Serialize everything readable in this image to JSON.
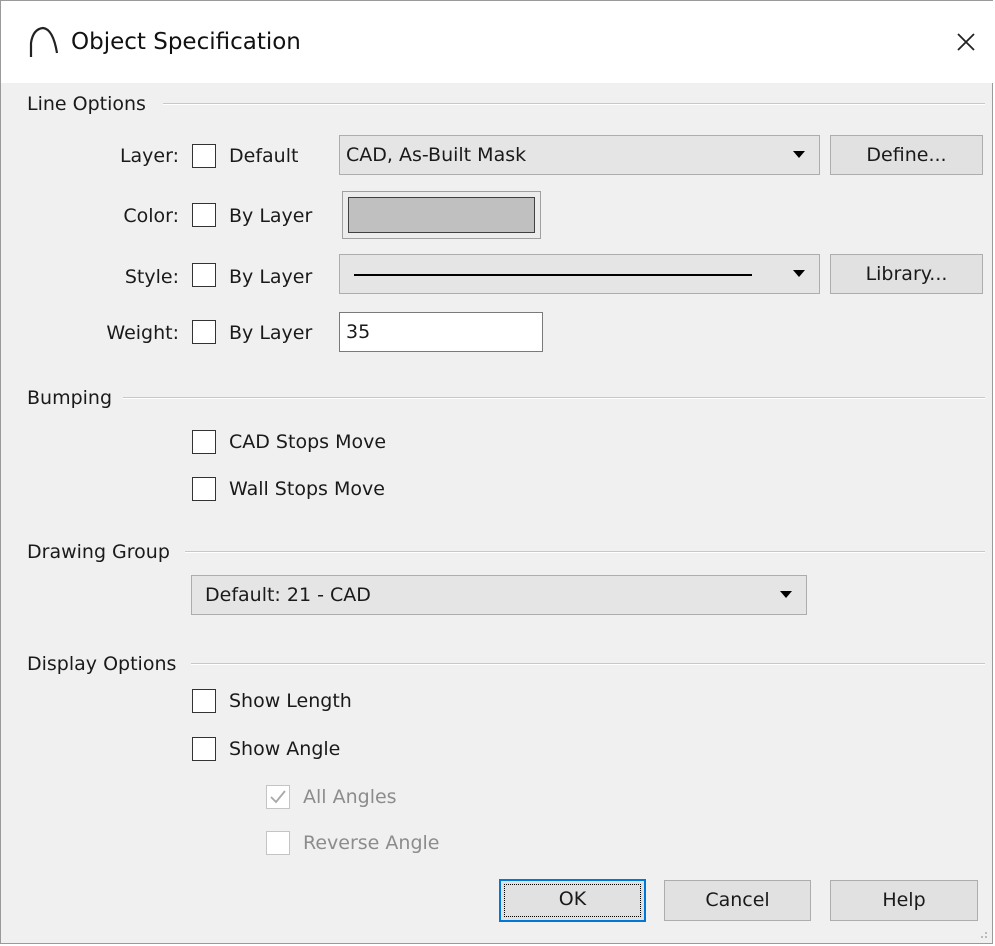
{
  "window": {
    "title": "Object Specification",
    "close_icon": "close-icon"
  },
  "line_options": {
    "group_label": "Line Options",
    "layer": {
      "label": "Layer:",
      "checkbox_label": "Default",
      "checked": false,
      "selected": "CAD, As-Built Mask",
      "button": "Define..."
    },
    "color": {
      "label": "Color:",
      "checkbox_label": "By Layer",
      "checked": false,
      "swatch_color": "#c0c0c0"
    },
    "style": {
      "label": "Style:",
      "checkbox_label": "By Layer",
      "checked": false,
      "selected": "solid-line",
      "button": "Library..."
    },
    "weight": {
      "label": "Weight:",
      "checkbox_label": "By Layer",
      "checked": false,
      "value": "35"
    }
  },
  "bumping": {
    "group_label": "Bumping",
    "cad_stops_move": {
      "label": "CAD Stops Move",
      "checked": false
    },
    "wall_stops_move": {
      "label": "Wall Stops Move",
      "checked": false
    }
  },
  "drawing_group": {
    "group_label": "Drawing Group",
    "selected": "Default: 21 - CAD"
  },
  "display_options": {
    "group_label": "Display Options",
    "show_length": {
      "label": "Show Length",
      "checked": false
    },
    "show_angle": {
      "label": "Show Angle",
      "checked": false
    },
    "all_angles": {
      "label": "All Angles",
      "checked": true,
      "enabled": false
    },
    "reverse_angle": {
      "label": "Reverse Angle",
      "checked": false,
      "enabled": false
    }
  },
  "buttons": {
    "ok": "OK",
    "cancel": "Cancel",
    "help": "Help"
  },
  "colors": {
    "accent": "#0078d7",
    "dialog_bg": "#f0f0f0"
  }
}
